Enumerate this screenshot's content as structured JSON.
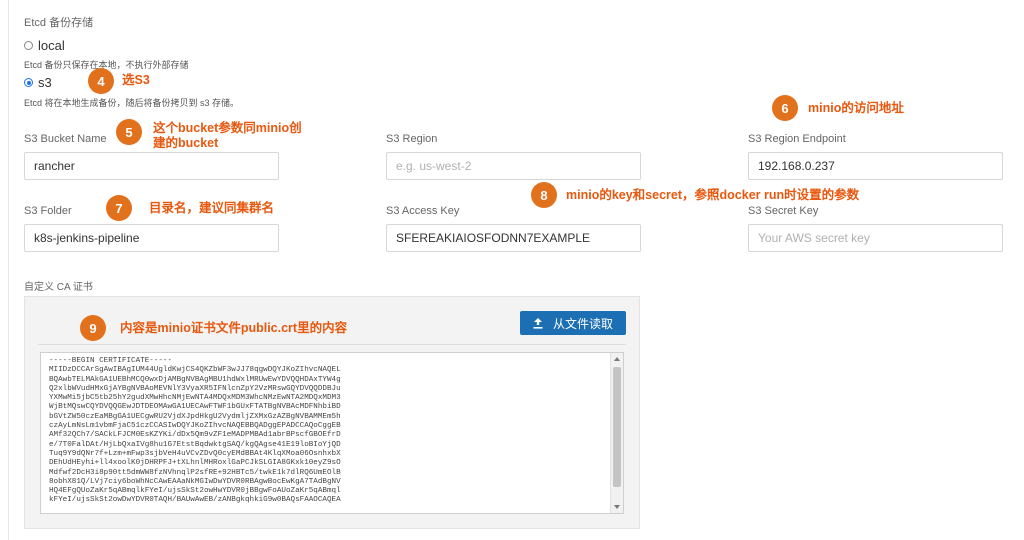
{
  "backup": {
    "section_title": "Etcd 备份存储",
    "local": {
      "label": "local",
      "selected": false,
      "help": "Etcd 备份只保存在本地，不执行外部存储"
    },
    "s3": {
      "label": "s3",
      "selected": true,
      "help": "Etcd 将在本地生成备份，随后将备份拷贝到 s3 存储。"
    }
  },
  "fields": {
    "bucket_name": {
      "label": "S3 Bucket Name",
      "value": "rancher",
      "placeholder": ""
    },
    "region": {
      "label": "S3 Region",
      "value": "",
      "placeholder": "e.g. us-west-2"
    },
    "endpoint": {
      "label": "S3 Region Endpoint",
      "value": "192.168.0.237",
      "placeholder": ""
    },
    "folder": {
      "label": "S3 Folder",
      "value": "k8s-jenkins-pipeline",
      "placeholder": ""
    },
    "access_key": {
      "label": "S3 Access Key",
      "value": "SFEREAKIAIOSFODNN7EXAMPLE",
      "placeholder": ""
    },
    "secret_key": {
      "label": "S3 Secret Key",
      "value": "",
      "placeholder": "Your AWS secret key"
    }
  },
  "ca": {
    "label": "自定义 CA 证书",
    "read_file_button": "从文件读取",
    "certificate_lines": [
      "-----BEGIN CERTIFICATE-----",
      "MIIDzDCCArSgAwIBAgIUM44UgldKwjCS4QKZbWF3wJJ78qgwDQYJKoZIhvcNAQEL",
      "BQAwbTELMAkGA1UEBhMCQ0wxDjAMBgNVBAgMBU1hdWxlMRUwEwYDVQQHDAxTYW4g",
      "Q2xlbWVudHMxGjAYBgNVBAoMEVNlY3VyaXR5IFNlcnZpY2VzMRswGQYDVQQDDBJu",
      "YXMwMi5jbC5tb25hY2gudXMwHhcNMjEwNTA4MDQxMDM3WhcNMzEwNTA2MDQxMDM3",
      "WjBtMQswCQYDVQQGEwJDTDEOMAwGA1UECAwFTWF1bGUxFTATBgNVBAcMDFNhbiBD",
      "bGVtZW50czEaMBgGA1UECgwRU2VjdXJpdHkgU2VydmljZXMxGzAZBgNVBAMMEm5h",
      "czAyLmNsLm1vbmFjaC51czCCASIwDQYJKoZIhvcNAQEBBQADggEPADCCAQoCggEB",
      "AMf32QCh7/SACkLFJCM0EsKZYKi/dDx5Qm9vZF1eMADPMBAd1abrBPscfGBOEfrD",
      "e/7T0FalDAt/HjLbQxaIVg8hu1G7EtstBqdwktgSAQ/kgQAgse41E19loBIoYjQD",
      "Tuq9Y9dQNr7f+Lzm+mFwp3sjbVeH4uVCvZDvQ0cyEMdBBAt4KlqXMoa06OsnhxbX",
      "DEhUdHEyhi+ll4xoolK0jDHRPFJ+tXLhnlMHRoxlGaPCJkSLGIA8GKxk10eyZ9sO",
      "Mdfwf2DcH3i8p90tt5dmWW8fzNVhnqlP2sfRE+92HBTc5/twkE1k7dlRQ6UmEOlB",
      "8obhX81Q/LVj7ciy6boWhNcCAwEAAaNkMGIwDwYDVR0RBAgwBocEwKgA7TAdBgNV",
      "HQ4EFgQUoZaKr5qABmqlkFYeI/ujsSkSt2owHwYDVR0jBBgwFoAUoZaKr5qABmql",
      "kFYeI/ujsSkSt2owDwYDVR0TAQH/BAUwAwEB/zANBgkqhkiG9w0BAQsFAAOCAQEA"
    ]
  },
  "annotations": {
    "n4": {
      "num": "4",
      "text": "选S3"
    },
    "n5": {
      "num": "5",
      "line1": "这个bucket参数同minio创",
      "line2": "建的bucket"
    },
    "n6": {
      "num": "6",
      "text": "minio的访问地址"
    },
    "n7": {
      "num": "7",
      "text": "目录名，建议同集群名"
    },
    "n8": {
      "num": "8",
      "text": "minio的key和secret，参照docker run时设置的参数"
    },
    "n9": {
      "num": "9",
      "text": "内容是minio证书文件public.crt里的内容"
    }
  }
}
